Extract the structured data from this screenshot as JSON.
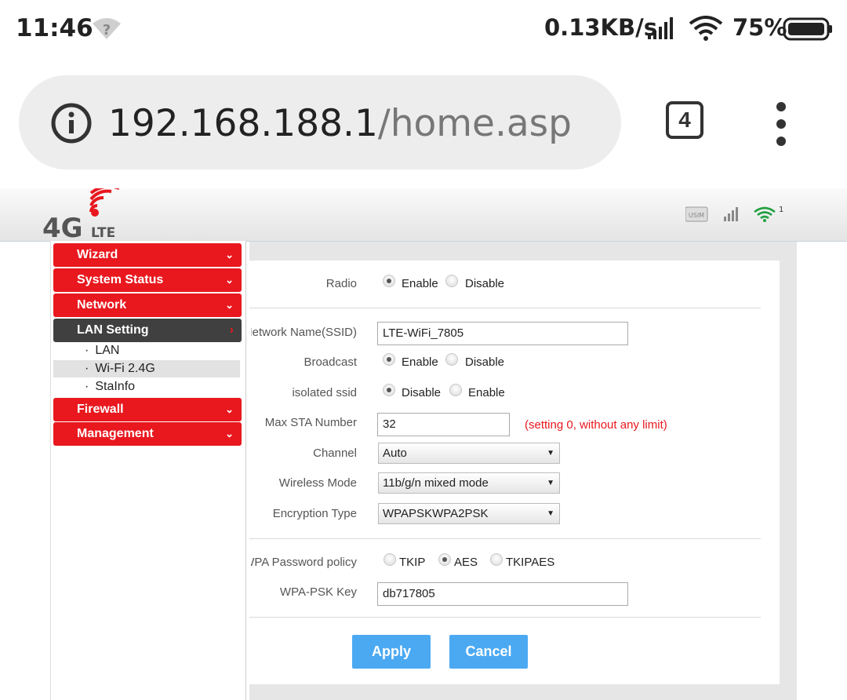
{
  "status_bar": {
    "time": "11:46",
    "net_speed": "0.13KB/s",
    "battery_pct": "75%",
    "icons": [
      "wifi-unknown-icon",
      "cell-signal-icon",
      "wifi-icon",
      "battery-icon"
    ]
  },
  "browser": {
    "url_host": "192.168.188.1",
    "url_path": "/home.asp",
    "tab_count": "4",
    "icons": [
      "info-icon",
      "tabs-icon",
      "overflow-menu-icon"
    ]
  },
  "router_header": {
    "logo_main": "4G",
    "logo_sub": "LTE",
    "wifi_clients": "1",
    "usim_label": "USIM",
    "icons": [
      "usim-icon",
      "signal-bars-icon",
      "wifi-status-icon"
    ]
  },
  "sidebar": {
    "menus": [
      {
        "label": "Wizard",
        "chevron": "⌄"
      },
      {
        "label": "System Status",
        "chevron": "⌄"
      },
      {
        "label": "Network",
        "chevron": "⌄"
      },
      {
        "label": "LAN Setting",
        "chevron": "›"
      },
      {
        "label": "Firewall",
        "chevron": "⌄"
      },
      {
        "label": "Management",
        "chevron": "⌄"
      }
    ],
    "lan_submenu": [
      {
        "label": "LAN",
        "bullet": "·"
      },
      {
        "label": "Wi-Fi 2.4G",
        "bullet": "·"
      },
      {
        "label": "StaInfo",
        "bullet": "·"
      }
    ]
  },
  "form": {
    "radio": {
      "label": "Radio",
      "options": [
        "Enable",
        "Disable"
      ],
      "selected": "Enable"
    },
    "ssid": {
      "label": "Network Name(SSID)",
      "value": "LTE-WiFi_7805"
    },
    "broadcast": {
      "label": "Broadcast",
      "options": [
        "Enable",
        "Disable"
      ],
      "selected": "Enable"
    },
    "isolated": {
      "label": "isolated ssid",
      "options": [
        "Disable",
        "Enable"
      ],
      "selected": "Disable"
    },
    "max_sta": {
      "label": "Max STA Number",
      "value": "32",
      "hint": "(setting 0, without any limit)"
    },
    "channel": {
      "label": "Channel",
      "value": "Auto"
    },
    "wireless_mode": {
      "label": "Wireless Mode",
      "value": "11b/g/n mixed mode"
    },
    "encryption": {
      "label": "Encryption Type",
      "value": "WPAPSKWPA2PSK"
    },
    "wpa_policy": {
      "label": "WPA Password policy",
      "options": [
        "TKIP",
        "AES",
        "TKIPAES"
      ],
      "selected": "AES"
    },
    "wpa_key": {
      "label": "WPA-PSK Key",
      "value": "db717805"
    },
    "select_arrow": "▼",
    "apply_label": "Apply",
    "cancel_label": "Cancel"
  },
  "colors": {
    "menu_red": "#e8181e",
    "menu_dark": "#404040",
    "button_blue": "#4ba9f2",
    "hint_red": "#e8181e"
  }
}
